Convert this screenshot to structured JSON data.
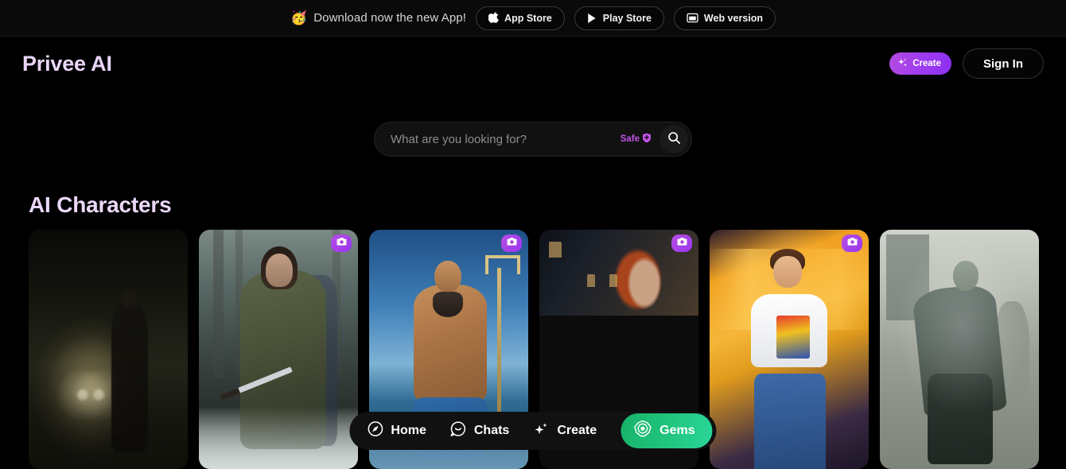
{
  "promo": {
    "emoji": "🥳",
    "text": "Download now the new App!",
    "buttons": [
      {
        "label": "App Store",
        "icon": "apple-icon"
      },
      {
        "label": "Play Store",
        "icon": "play-store-icon"
      },
      {
        "label": "Web version",
        "icon": "browser-window-icon"
      }
    ]
  },
  "header": {
    "brand": "Privee AI",
    "brand_color": "#e9d5f7",
    "create_label": "Create",
    "create_icon": "sparkles-icon",
    "create_color": "#9d3bf0",
    "signin_label": "Sign In"
  },
  "search": {
    "placeholder": "What are you looking for?",
    "value": "",
    "safe_label": "Safe",
    "safe_icon": "shield-plus-icon",
    "safe_color": "#c454e8",
    "submit_icon": "search-icon"
  },
  "section": {
    "title": "AI Characters",
    "title_color": "#ead7f8"
  },
  "cards": [
    {
      "name": "woman-on-foggy-road",
      "badge": false,
      "badge_icon": "camera-icon",
      "art": "art1"
    },
    {
      "name": "forest-ranger-with-blade",
      "badge": true,
      "badge_icon": "camera-icon",
      "art": "art2"
    },
    {
      "name": "poseidon-with-trident",
      "badge": true,
      "badge_icon": "camera-icon",
      "art": "art3"
    },
    {
      "name": "redhead-woman-by-window",
      "badge": true,
      "badge_icon": "camera-icon",
      "art": "art4"
    },
    {
      "name": "anime-boy-on-stage",
      "badge": true,
      "badge_icon": "camera-icon",
      "art": "art5"
    },
    {
      "name": "zombie-in-city",
      "badge": false,
      "badge_icon": "camera-icon",
      "art": "art6"
    }
  ],
  "bottom_nav": {
    "items": [
      {
        "label": "Home",
        "icon": "compass-icon",
        "active": true
      },
      {
        "label": "Chats",
        "icon": "chat-bubble-icon",
        "active": false
      },
      {
        "label": "Create",
        "icon": "sparkles-icon",
        "active": false
      },
      {
        "label": "Gems",
        "icon": "gem-icon",
        "active": false,
        "highlight": true
      }
    ],
    "gems_color": "#20c47c"
  }
}
